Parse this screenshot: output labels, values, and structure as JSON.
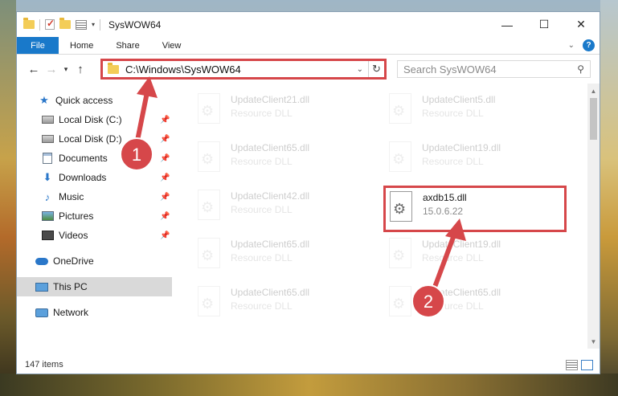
{
  "window": {
    "title": "SysWOW64",
    "minimize_icon": "minimize-icon",
    "maximize_icon": "maximize-icon",
    "close_icon": "close-icon"
  },
  "ribbon": {
    "tabs": [
      "File",
      "Home",
      "Share",
      "View"
    ],
    "help_label": "?"
  },
  "navbar": {
    "address": "C:\\Windows\\SysWOW64",
    "search_placeholder": "Search SysWOW64"
  },
  "sidebar": {
    "items": [
      {
        "label": "Quick access",
        "icon": "star-icon"
      },
      {
        "label": "Local Disk (C:)",
        "icon": "drive-icon",
        "pinned": true
      },
      {
        "label": "Local Disk (D:)",
        "icon": "drive-icon",
        "pinned": true
      },
      {
        "label": "Documents",
        "icon": "documents-icon",
        "pinned": true
      },
      {
        "label": "Downloads",
        "icon": "downloads-icon",
        "pinned": true
      },
      {
        "label": "Music",
        "icon": "music-icon",
        "pinned": true
      },
      {
        "label": "Pictures",
        "icon": "pictures-icon",
        "pinned": true
      },
      {
        "label": "Videos",
        "icon": "videos-icon",
        "pinned": true
      },
      {
        "label": "OneDrive",
        "icon": "onedrive-icon"
      },
      {
        "label": "This PC",
        "icon": "this-pc-icon",
        "selected": true
      },
      {
        "label": "Network",
        "icon": "network-icon"
      }
    ]
  },
  "files": [
    {
      "name": "UpdateClient21.dll",
      "type": "Resource DLL"
    },
    {
      "name": "UpdateClient5.dll",
      "type": "Resource DLL"
    },
    {
      "name": "UpdateClient65.dll",
      "type": "Resource DLL"
    },
    {
      "name": "UpdateClient19.dll",
      "type": "Resource DLL"
    },
    {
      "name": "UpdateClient42.dll",
      "type": "Resource DLL"
    },
    {
      "name": "axdb15.dll",
      "type": "15.0.6.22",
      "highlighted": true
    },
    {
      "name": "UpdateClient65.dll",
      "type": "Resource DLL"
    },
    {
      "name": "UpdateClient19.dll",
      "type": "Resource DLL"
    },
    {
      "name": "UpdateClient65.dll",
      "type": "Resource DLL"
    },
    {
      "name": "UpdateClient65.dll",
      "type": "Resource DLL"
    }
  ],
  "status": {
    "item_count": "147 items"
  },
  "annotations": {
    "step1": "1",
    "step2": "2",
    "color": "#d6474a"
  }
}
